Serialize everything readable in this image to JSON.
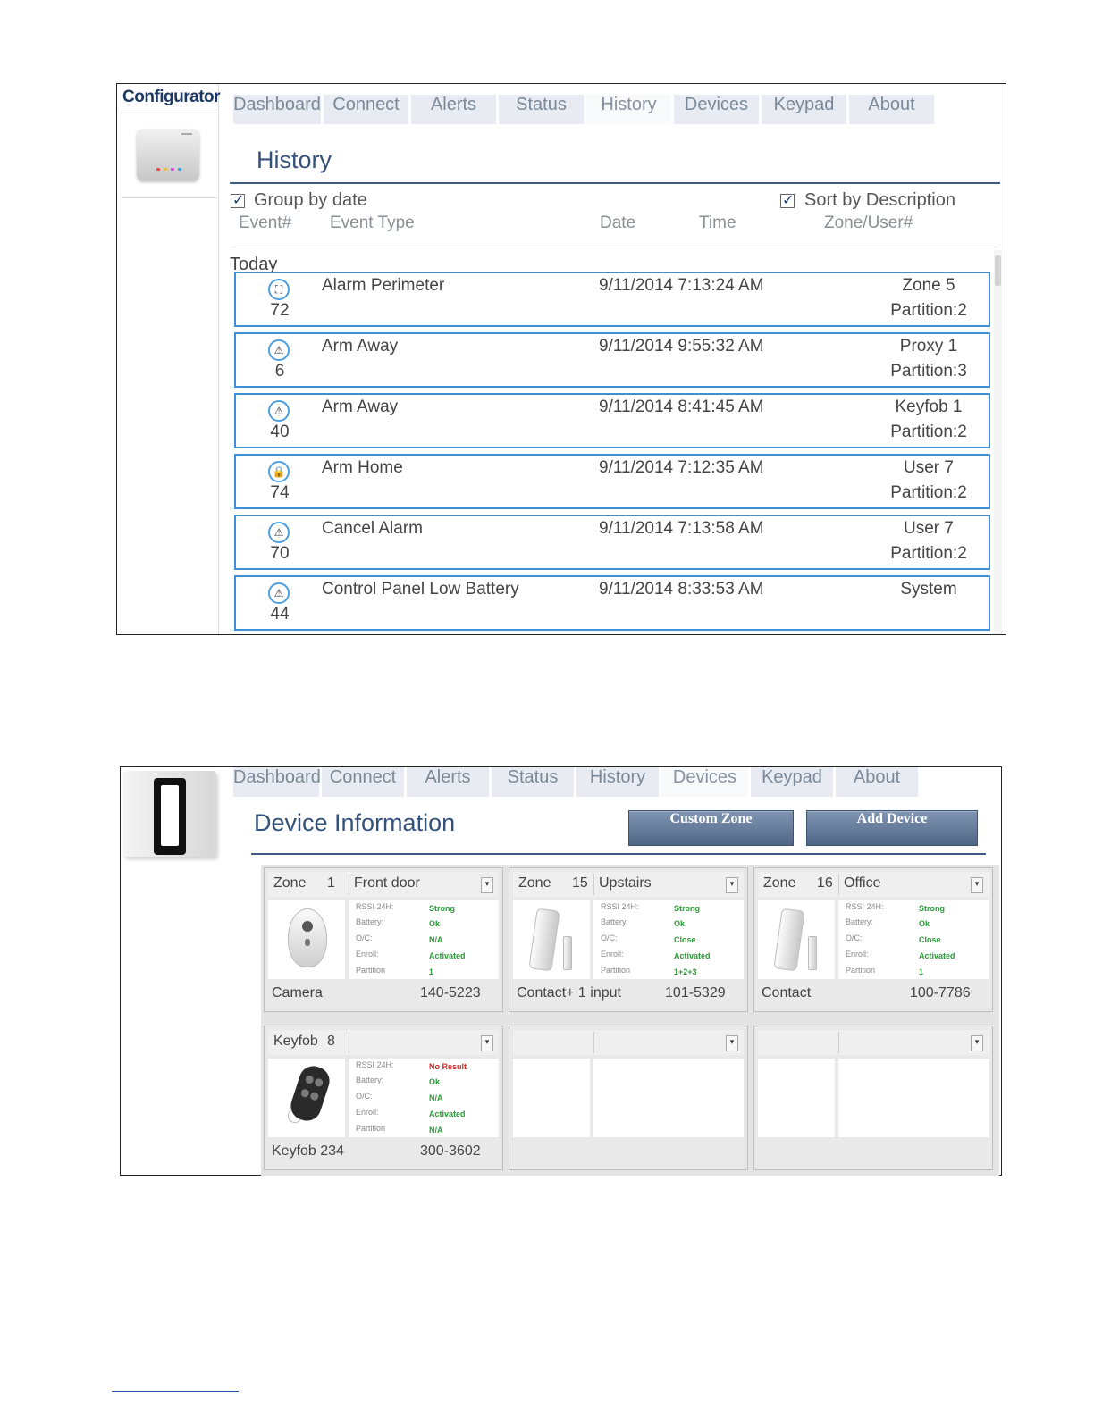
{
  "tabs": [
    "Dashboard",
    "Connect",
    "Alerts",
    "Status",
    "History",
    "Devices",
    "Keypad",
    "About"
  ],
  "history_screen": {
    "brand": "Configurator",
    "active_tab": "History",
    "title": "History",
    "group_by_date_label": "Group by date",
    "group_by_date_checked": true,
    "sort_by_description_label": "Sort by Description",
    "sort_by_description_checked": true,
    "columns": [
      "Event#",
      "Event Type",
      "Date",
      "Time",
      "Zone/User#"
    ],
    "group_label": "Today",
    "events": [
      {
        "icon": "perimeter-icon",
        "glyph": "⛶",
        "number": "72",
        "type": "Alarm Perimeter",
        "datetime": "9/11/2014 7:13:24 AM",
        "zone": "Zone 5",
        "partition": "Partition:2"
      },
      {
        "icon": "warning-icon",
        "glyph": "⚠",
        "number": "6",
        "type": "Arm Away",
        "datetime": "9/11/2014 9:55:32 AM",
        "zone": "Proxy 1",
        "partition": "Partition:3"
      },
      {
        "icon": "warning-icon",
        "glyph": "⚠",
        "number": "40",
        "type": "Arm Away",
        "datetime": "9/11/2014 8:41:45 AM",
        "zone": "Keyfob 1",
        "partition": "Partition:2"
      },
      {
        "icon": "lock-icon",
        "glyph": "🔒",
        "number": "74",
        "type": "Arm Home",
        "datetime": "9/11/2014 7:12:35 AM",
        "zone": "User 7",
        "partition": "Partition:2"
      },
      {
        "icon": "warning-icon",
        "glyph": "⚠",
        "number": "70",
        "type": "Cancel Alarm",
        "datetime": "9/11/2014 7:13:58 AM",
        "zone": "User 7",
        "partition": "Partition:2"
      },
      {
        "icon": "warning-icon",
        "glyph": "⚠",
        "number": "44",
        "type": "Control Panel Low Battery",
        "datetime": "9/11/2014 8:33:53 AM",
        "zone": "System",
        "partition": ""
      }
    ]
  },
  "devices_screen": {
    "active_tab": "Devices",
    "title": "Device Information",
    "custom_zone_button": "Custom Zone",
    "add_device_button": "Add Device",
    "field_labels": [
      "RSSI 24H:",
      "Battery:",
      "O/C:",
      "Enroll:",
      "Partition"
    ],
    "cards": [
      {
        "kind": "Zone",
        "number": "1",
        "location": "Front door",
        "image": "camera",
        "values": [
          "Strong",
          "Ok",
          "N/A",
          "Activated",
          "1"
        ],
        "rssi_ok": true,
        "type": "Camera",
        "id": "140-5223"
      },
      {
        "kind": "Zone",
        "number": "15",
        "location": "Upstairs",
        "image": "contact",
        "values": [
          "Strong",
          "Ok",
          "Close",
          "Activated",
          "1+2+3"
        ],
        "rssi_ok": true,
        "type": "Contact+ 1 input",
        "id": "101-5329"
      },
      {
        "kind": "Zone",
        "number": "16",
        "location": "Office",
        "image": "contact",
        "values": [
          "Strong",
          "Ok",
          "Close",
          "Activated",
          "1"
        ],
        "rssi_ok": true,
        "type": "Contact",
        "id": "100-7786"
      },
      {
        "kind": "Keyfob",
        "number": "8",
        "location": "",
        "image": "keyfob",
        "values": [
          "No Result",
          "Ok",
          "N/A",
          "Activated",
          "N/A"
        ],
        "rssi_ok": false,
        "type": "Keyfob 234",
        "id": "300-3602"
      },
      {
        "kind": "",
        "number": "",
        "location": "",
        "image": "",
        "values": [],
        "rssi_ok": true,
        "type": "",
        "id": ""
      },
      {
        "kind": "",
        "number": "",
        "location": "",
        "image": "",
        "values": [],
        "rssi_ok": true,
        "type": "",
        "id": ""
      }
    ]
  },
  "colors": {
    "accent_blue": "#3f8fd8",
    "title_blue": "#34527c",
    "ok_green": "#2a9b35",
    "error_red": "#e02424",
    "button_navy": "#4f6686"
  }
}
